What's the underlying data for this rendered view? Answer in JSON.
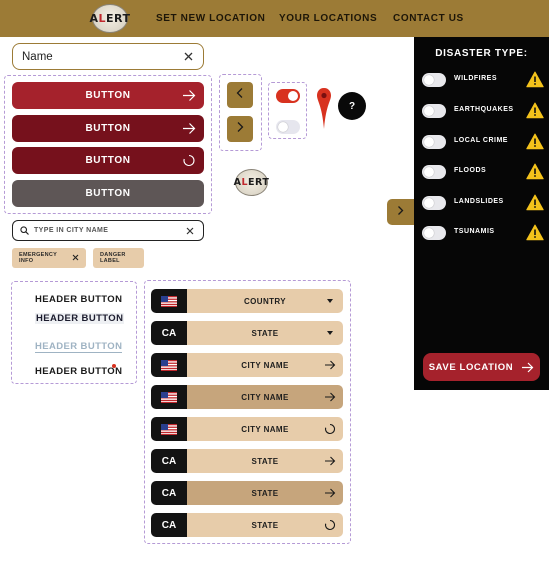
{
  "nav": {
    "logo_text": "ALERT",
    "links": [
      "SET NEW LOCATION",
      "YOUR LOCATIONS",
      "CONTACT US"
    ]
  },
  "name_input": {
    "value": "Name"
  },
  "buttons": [
    "BUTTON",
    "BUTTON",
    "BUTTON",
    "BUTTON"
  ],
  "toggles_demo": [
    {
      "state": "on",
      "color": "#d8321f"
    },
    {
      "state": "off",
      "color": "#e6e6ee"
    }
  ],
  "help_badge": "?",
  "logo_small_text": "ALERT",
  "city_search": {
    "placeholder": "TYPE IN CITY NAME"
  },
  "chips": {
    "emergency": "EMERGENCY INFO",
    "danger": "DANGER LABEL"
  },
  "header_buttons": [
    "HEADER BUTTON",
    "HEADER BUTTON",
    "HEADER BUTTON",
    "HEADER BUTTON"
  ],
  "location_rows": [
    {
      "lead": "flag",
      "label": "COUNTRY",
      "icon": "caret-down-icon"
    },
    {
      "lead": "CA",
      "label": "STATE",
      "icon": "caret-down-icon"
    },
    {
      "lead": "flag",
      "label": "CITY NAME",
      "icon": "arrow-right-icon"
    },
    {
      "lead": "flag",
      "label": "CITY NAME",
      "icon": "arrow-right-icon"
    },
    {
      "lead": "flag",
      "label": "CITY NAME",
      "icon": "spinner-icon"
    },
    {
      "lead": "CA",
      "label": "STATE",
      "icon": "arrow-right-icon"
    },
    {
      "lead": "CA",
      "label": "STATE",
      "icon": "arrow-right-icon"
    },
    {
      "lead": "CA",
      "label": "STATE",
      "icon": "spinner-icon"
    }
  ],
  "sidebar": {
    "title": "DISASTER TYPE:",
    "items": [
      "WILDFIRES",
      "EARTHQUAKES",
      "LOCAL CRIME",
      "FLOODS",
      "LANDSLIDES",
      "TSUNAMIS"
    ],
    "save_label": "SAVE LOCATION"
  },
  "colors": {
    "brand_gold": "#9c7b36",
    "alert_red": "#a5222c",
    "tan": "#e7ccaa",
    "tan_dark": "#c6a57c",
    "warning_yellow": "#f3c21b"
  }
}
